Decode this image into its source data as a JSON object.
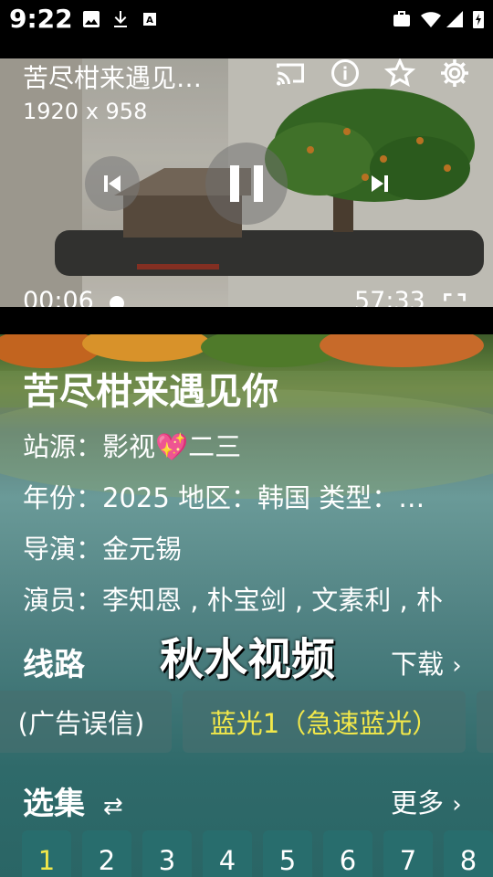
{
  "status_bar": {
    "time": "9:22"
  },
  "player": {
    "title": "苦尽柑来遇见…",
    "resolution": "1920 x 958",
    "current_time": "00:06",
    "duration": "57:33"
  },
  "info": {
    "title": "苦尽柑来遇见你",
    "source": "站源：影视💖二三",
    "details": "年份：2025  地区：韩国  类型：…",
    "director": "导演：金元锡",
    "actors": "演员：李知恩 , 朴宝剑 , 文素利 , 朴"
  },
  "lines": {
    "header": "线路",
    "download_label": "下载",
    "watermark": "秋水视频",
    "items": [
      {
        "label": "(广告误信)",
        "active": false
      },
      {
        "label": "蓝光1（急速蓝光）",
        "active": true
      }
    ]
  },
  "episodes": {
    "header": "选集",
    "more_label": "更多",
    "items": [
      "1",
      "2",
      "3",
      "4",
      "5",
      "6",
      "7",
      "8"
    ],
    "selected_index": 0
  },
  "colors": {
    "active_text": "#f2e84a",
    "accent_bg": "#2b7474"
  }
}
